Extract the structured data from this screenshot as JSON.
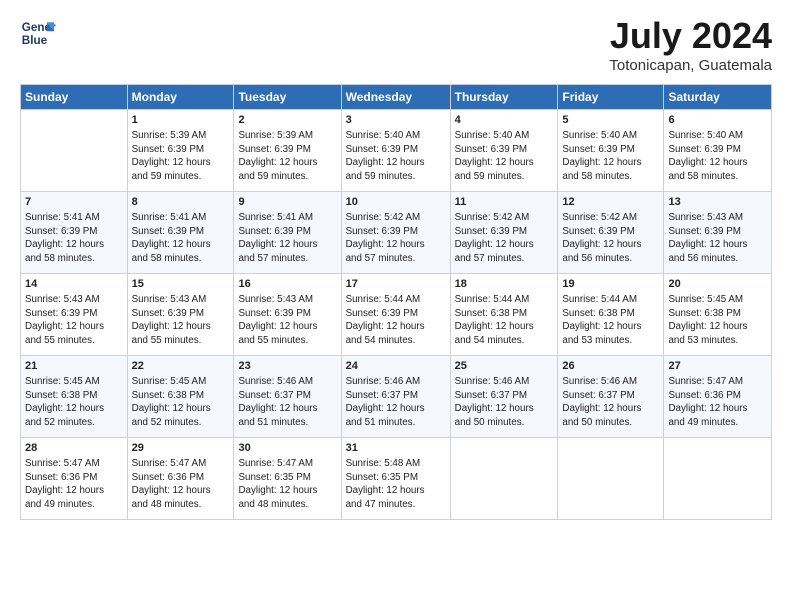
{
  "logo": {
    "line1": "General",
    "line2": "Blue"
  },
  "title": "July 2024",
  "location": "Totonicapan, Guatemala",
  "days_header": [
    "Sunday",
    "Monday",
    "Tuesday",
    "Wednesday",
    "Thursday",
    "Friday",
    "Saturday"
  ],
  "weeks": [
    [
      {
        "day": "",
        "info": ""
      },
      {
        "day": "1",
        "info": "Sunrise: 5:39 AM\nSunset: 6:39 PM\nDaylight: 12 hours\nand 59 minutes."
      },
      {
        "day": "2",
        "info": "Sunrise: 5:39 AM\nSunset: 6:39 PM\nDaylight: 12 hours\nand 59 minutes."
      },
      {
        "day": "3",
        "info": "Sunrise: 5:40 AM\nSunset: 6:39 PM\nDaylight: 12 hours\nand 59 minutes."
      },
      {
        "day": "4",
        "info": "Sunrise: 5:40 AM\nSunset: 6:39 PM\nDaylight: 12 hours\nand 59 minutes."
      },
      {
        "day": "5",
        "info": "Sunrise: 5:40 AM\nSunset: 6:39 PM\nDaylight: 12 hours\nand 58 minutes."
      },
      {
        "day": "6",
        "info": "Sunrise: 5:40 AM\nSunset: 6:39 PM\nDaylight: 12 hours\nand 58 minutes."
      }
    ],
    [
      {
        "day": "7",
        "info": "Sunrise: 5:41 AM\nSunset: 6:39 PM\nDaylight: 12 hours\nand 58 minutes."
      },
      {
        "day": "8",
        "info": "Sunrise: 5:41 AM\nSunset: 6:39 PM\nDaylight: 12 hours\nand 58 minutes."
      },
      {
        "day": "9",
        "info": "Sunrise: 5:41 AM\nSunset: 6:39 PM\nDaylight: 12 hours\nand 57 minutes."
      },
      {
        "day": "10",
        "info": "Sunrise: 5:42 AM\nSunset: 6:39 PM\nDaylight: 12 hours\nand 57 minutes."
      },
      {
        "day": "11",
        "info": "Sunrise: 5:42 AM\nSunset: 6:39 PM\nDaylight: 12 hours\nand 57 minutes."
      },
      {
        "day": "12",
        "info": "Sunrise: 5:42 AM\nSunset: 6:39 PM\nDaylight: 12 hours\nand 56 minutes."
      },
      {
        "day": "13",
        "info": "Sunrise: 5:43 AM\nSunset: 6:39 PM\nDaylight: 12 hours\nand 56 minutes."
      }
    ],
    [
      {
        "day": "14",
        "info": "Sunrise: 5:43 AM\nSunset: 6:39 PM\nDaylight: 12 hours\nand 55 minutes."
      },
      {
        "day": "15",
        "info": "Sunrise: 5:43 AM\nSunset: 6:39 PM\nDaylight: 12 hours\nand 55 minutes."
      },
      {
        "day": "16",
        "info": "Sunrise: 5:43 AM\nSunset: 6:39 PM\nDaylight: 12 hours\nand 55 minutes."
      },
      {
        "day": "17",
        "info": "Sunrise: 5:44 AM\nSunset: 6:39 PM\nDaylight: 12 hours\nand 54 minutes."
      },
      {
        "day": "18",
        "info": "Sunrise: 5:44 AM\nSunset: 6:38 PM\nDaylight: 12 hours\nand 54 minutes."
      },
      {
        "day": "19",
        "info": "Sunrise: 5:44 AM\nSunset: 6:38 PM\nDaylight: 12 hours\nand 53 minutes."
      },
      {
        "day": "20",
        "info": "Sunrise: 5:45 AM\nSunset: 6:38 PM\nDaylight: 12 hours\nand 53 minutes."
      }
    ],
    [
      {
        "day": "21",
        "info": "Sunrise: 5:45 AM\nSunset: 6:38 PM\nDaylight: 12 hours\nand 52 minutes."
      },
      {
        "day": "22",
        "info": "Sunrise: 5:45 AM\nSunset: 6:38 PM\nDaylight: 12 hours\nand 52 minutes."
      },
      {
        "day": "23",
        "info": "Sunrise: 5:46 AM\nSunset: 6:37 PM\nDaylight: 12 hours\nand 51 minutes."
      },
      {
        "day": "24",
        "info": "Sunrise: 5:46 AM\nSunset: 6:37 PM\nDaylight: 12 hours\nand 51 minutes."
      },
      {
        "day": "25",
        "info": "Sunrise: 5:46 AM\nSunset: 6:37 PM\nDaylight: 12 hours\nand 50 minutes."
      },
      {
        "day": "26",
        "info": "Sunrise: 5:46 AM\nSunset: 6:37 PM\nDaylight: 12 hours\nand 50 minutes."
      },
      {
        "day": "27",
        "info": "Sunrise: 5:47 AM\nSunset: 6:36 PM\nDaylight: 12 hours\nand 49 minutes."
      }
    ],
    [
      {
        "day": "28",
        "info": "Sunrise: 5:47 AM\nSunset: 6:36 PM\nDaylight: 12 hours\nand 49 minutes."
      },
      {
        "day": "29",
        "info": "Sunrise: 5:47 AM\nSunset: 6:36 PM\nDaylight: 12 hours\nand 48 minutes."
      },
      {
        "day": "30",
        "info": "Sunrise: 5:47 AM\nSunset: 6:35 PM\nDaylight: 12 hours\nand 48 minutes."
      },
      {
        "day": "31",
        "info": "Sunrise: 5:48 AM\nSunset: 6:35 PM\nDaylight: 12 hours\nand 47 minutes."
      },
      {
        "day": "",
        "info": ""
      },
      {
        "day": "",
        "info": ""
      },
      {
        "day": "",
        "info": ""
      }
    ]
  ]
}
